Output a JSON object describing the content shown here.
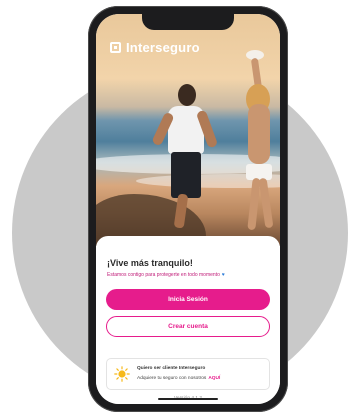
{
  "brand": {
    "name": "Interseguro"
  },
  "panel": {
    "headline": "¡Vive más tranquilo!",
    "subline": "Estamos contigo para protegerte en todo momento",
    "primary_button": "Inicia Sesión",
    "secondary_button": "Crear cuenta"
  },
  "promo": {
    "title": "Quiero ser cliente Interseguro",
    "body": "Adquiere tu seguro con nosotros",
    "link": "AQUÍ"
  },
  "footer": {
    "version": "Versión 4.1.2"
  },
  "colors": {
    "accent": "#e61c8c",
    "background_circle": "#c9c9c9"
  },
  "icons": {
    "brand": "interseguro-logo-icon",
    "promo": "sun-icon",
    "subline": "heart-icon"
  }
}
